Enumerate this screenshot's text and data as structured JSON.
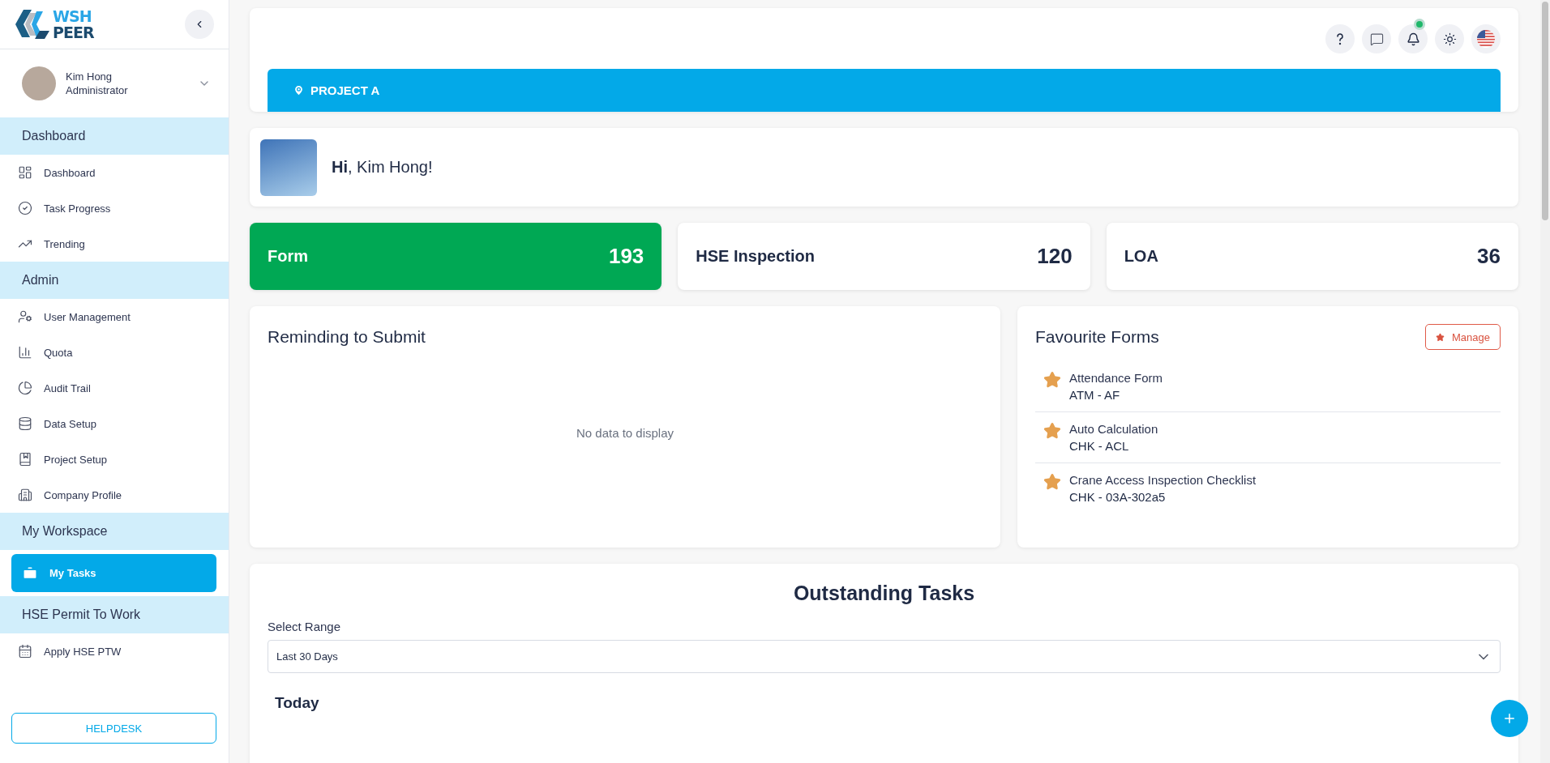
{
  "sidebar": {
    "logo": {
      "line_1": "WSH",
      "line_2": "PEER"
    },
    "user": {
      "name": "Kim Hong",
      "role": "Administrator"
    },
    "sections": [
      {
        "title": "Dashboard",
        "items": [
          {
            "label": "Dashboard",
            "selected": false
          },
          {
            "label": "Task Progress",
            "selected": false
          },
          {
            "label": "Trending",
            "selected": false
          }
        ]
      },
      {
        "title": "Admin",
        "items": [
          {
            "label": "User Management",
            "selected": false
          },
          {
            "label": "Quota",
            "selected": false
          },
          {
            "label": "Audit Trail",
            "selected": false
          },
          {
            "label": "Data Setup",
            "selected": false
          },
          {
            "label": "Project Setup",
            "selected": false
          },
          {
            "label": "Company Profile",
            "selected": false
          }
        ]
      },
      {
        "title": "My Workspace",
        "items": [
          {
            "label": "My Tasks",
            "selected": true
          }
        ]
      },
      {
        "title": "HSE Permit To Work",
        "items": [
          {
            "label": "Apply HSE PTW",
            "selected": false
          }
        ]
      }
    ],
    "helpdesk": "HELPDESK"
  },
  "header": {
    "notification_dot": true,
    "project": "PROJECT A"
  },
  "greeting": "**Hi**, Kim Hong!",
  "stats": [
    {
      "label": "Form",
      "value": "193",
      "selected": true
    },
    {
      "label": "HSE Inspection",
      "value": "120",
      "selected": false
    },
    {
      "label": "LOA",
      "value": "36",
      "selected": false
    }
  ],
  "reminding": {
    "title": "Reminding to Submit",
    "empty_text": "No data to display"
  },
  "favourites": {
    "title": "Favourite Forms",
    "manage": "Manage",
    "items": [
      {
        "name": "Attendance Form",
        "code": "ATM - AF"
      },
      {
        "name": "Auto Calculation",
        "code": "CHK - ACL"
      },
      {
        "name": "Crane Access Inspection Checklist",
        "code": "CHK - 03A-302a5"
      }
    ]
  },
  "outstanding": {
    "title": "Outstanding Tasks",
    "range_label": "Select Range",
    "range_value": "Last 30 Days",
    "today": "Today"
  }
}
